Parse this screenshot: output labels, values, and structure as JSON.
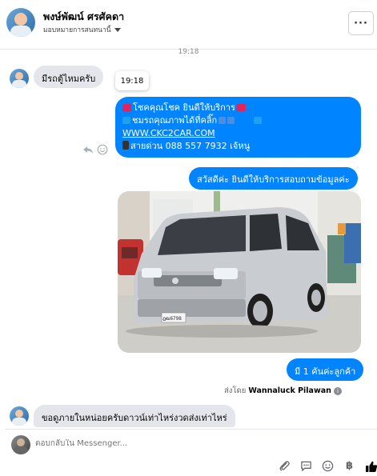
{
  "header": {
    "name": "พงษ์พัฒน์ ศรศัคดา",
    "assign_label": "มอบหมายการสนทนานี้",
    "more_label": "···"
  },
  "conversation": {
    "top_time": "19:18",
    "hover_time": "19:18",
    "incoming_1": "มีรถตู้ไหมครับ",
    "outgoing_multi": {
      "line1": "โชคคุณโชค ยินดีให้บริการ",
      "line2": "ชมรถคุณภาพได้ที่คลิ๊ก",
      "line3": "WWW.CKC2CAR.COM",
      "line4": "สายด่วน 088 557 7932 เจ้หนู"
    },
    "outgoing_greeting": "สวัสดีค่ะ  ยินดีให้บริการสอบถามข้อมูลค่ะ",
    "outgoing_count": "มี 1 คันค่ะลูกค้า",
    "sent_by_prefix": "ส่งโดย",
    "sent_by_name": "Wannaluck Pilawan",
    "incoming_2": "ขอดูภายในหน่อยครับดาวน์เท่าไหร่งวดส่งเท่าไหร่"
  },
  "composer": {
    "placeholder": "ตอบกลับใน Messenger..."
  },
  "photo": {
    "plate": "ฎฒ6798"
  },
  "icons": [
    "reply-icon",
    "smiley-icon",
    "paperclip-icon",
    "saved-reply-icon",
    "emoji-icon",
    "baht-icon",
    "thumbs-up-icon"
  ],
  "colors": {
    "outgoing_bubble": "#0084ff",
    "incoming_bubble": "#e4e6eb",
    "accent_like": "#050505"
  }
}
